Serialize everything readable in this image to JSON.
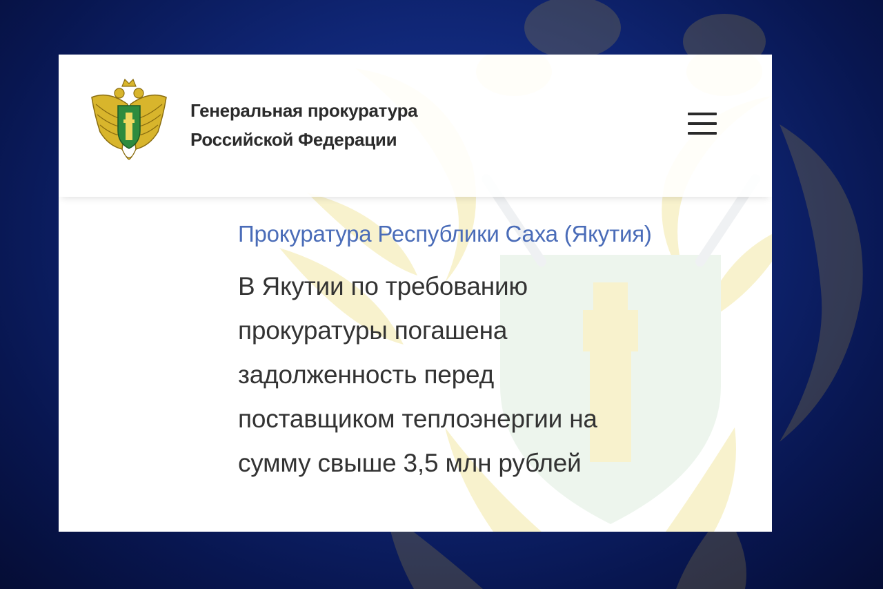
{
  "header": {
    "org_title_lines": [
      "Генеральная прокуратура",
      "Российской Федерации"
    ],
    "logo_icon": "prosecutor-emblem-icon",
    "menu_icon": "hamburger-menu-icon"
  },
  "article": {
    "source": "Прокуратура Республики Саха (Якутия)",
    "headline_lines": [
      "В Якутии по требованию",
      "прокуратуры погашена",
      "задолженность перед",
      "поставщиком теплоэнергии на",
      "сумму свыше 3,5 млн рублей"
    ]
  },
  "colors": {
    "background": "#0f2573",
    "source_link": "#4a6cb8",
    "headline_text": "#333333",
    "emblem_gold": "#e8c840",
    "emblem_green": "#2e8b3e"
  }
}
